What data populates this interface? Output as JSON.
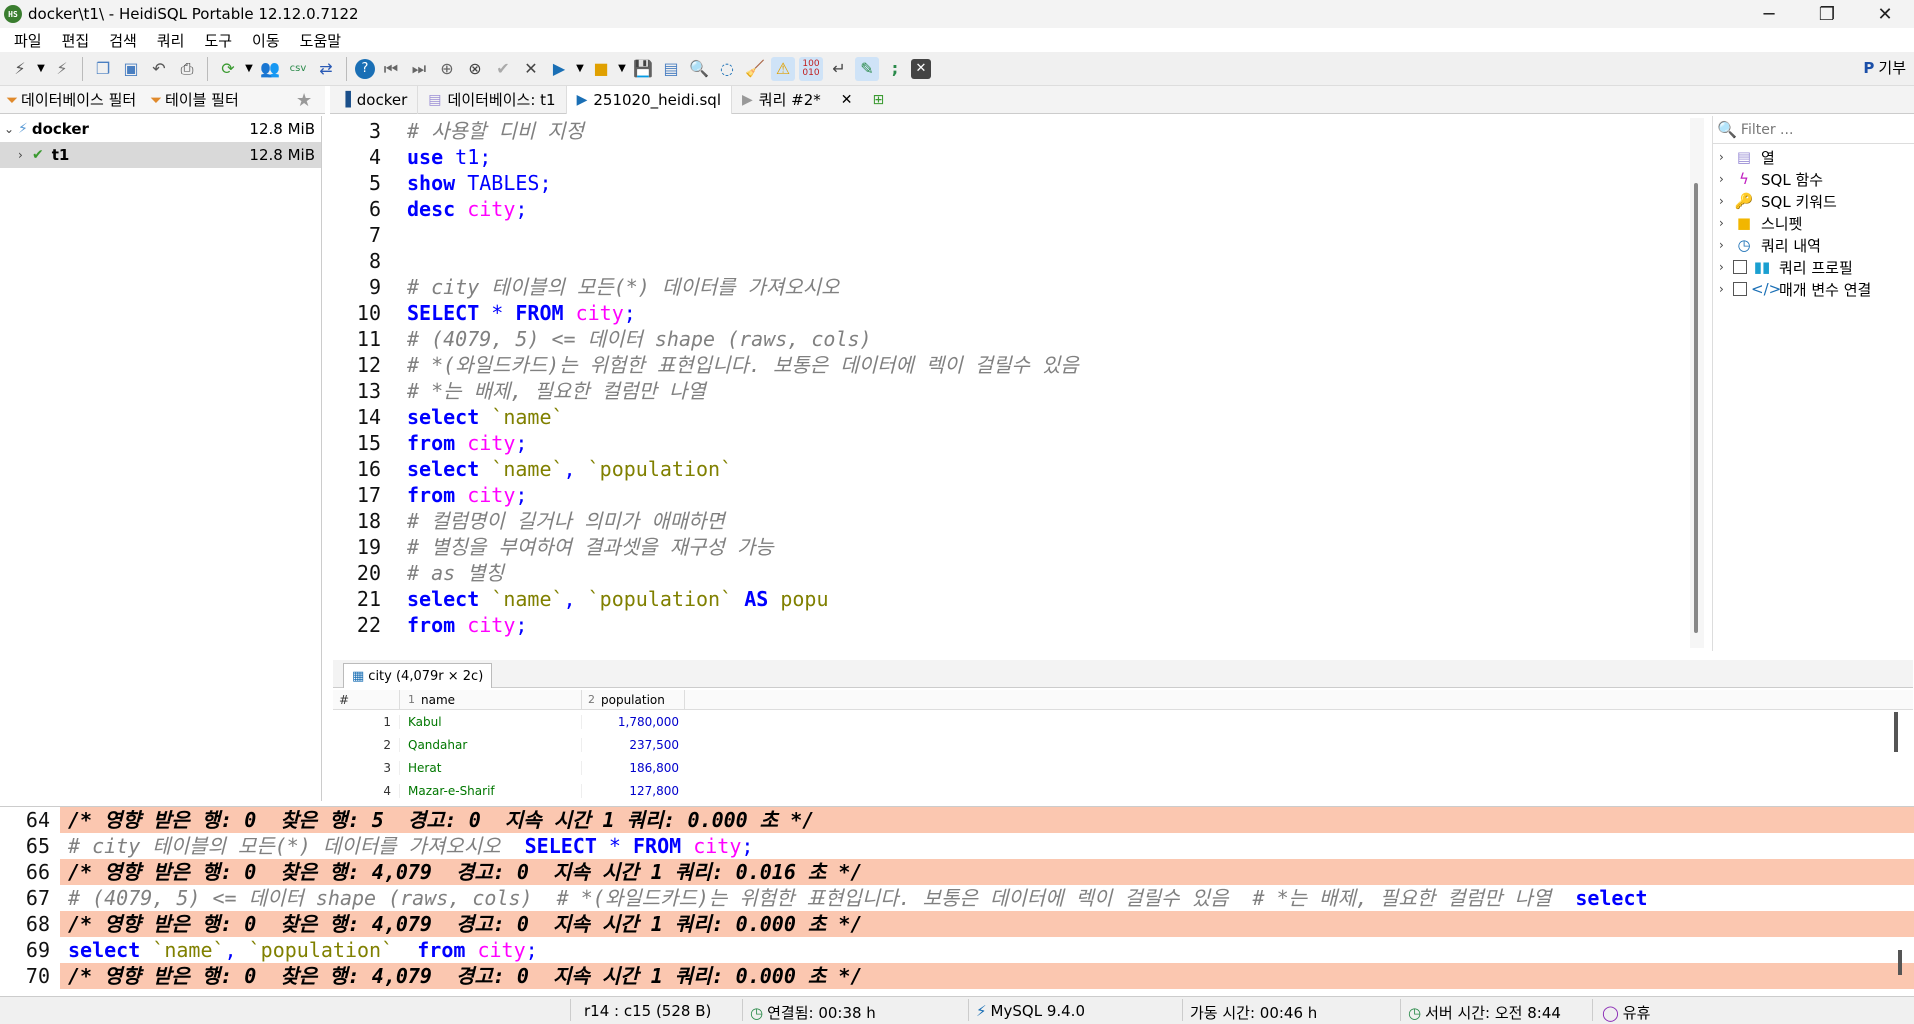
{
  "window": {
    "title": "docker\\t1\\ - HeidiSQL Portable 12.12.0.7122",
    "minimize": "─",
    "maximize": "❐",
    "close": "✕"
  },
  "menu": [
    "파일",
    "편집",
    "검색",
    "쿼리",
    "도구",
    "이동",
    "도움말"
  ],
  "donate_label": "기부",
  "left_tabs": {
    "db_filter": "데이터베이스 필터",
    "table_filter": "테이블 필터"
  },
  "tree": [
    {
      "name": "docker",
      "size": "12.8 MiB"
    },
    {
      "name": "t1",
      "size": "12.8 MiB"
    }
  ],
  "query_tabs": [
    {
      "label": "docker"
    },
    {
      "label": "데이터베이스: t1"
    },
    {
      "label": "251020_heidi.sql"
    },
    {
      "label": "쿼리 #2*"
    }
  ],
  "editor_lines": [
    {
      "n": "3",
      "parts": [
        {
          "t": "# 사용할 디비 지정",
          "c": "cm"
        }
      ]
    },
    {
      "n": "4",
      "parts": [
        {
          "t": "use",
          "c": "kw"
        },
        {
          "t": " t1;",
          "c": "pl"
        }
      ]
    },
    {
      "n": "5",
      "parts": [
        {
          "t": "show",
          "c": "kw"
        },
        {
          "t": " TABLES;",
          "c": "pl"
        }
      ]
    },
    {
      "n": "6",
      "parts": [
        {
          "t": "desc",
          "c": "kw"
        },
        {
          "t": " ",
          "c": "pl"
        },
        {
          "t": "city",
          "c": "id"
        },
        {
          "t": ";",
          "c": "pl"
        }
      ]
    },
    {
      "n": "7",
      "parts": []
    },
    {
      "n": "8",
      "parts": []
    },
    {
      "n": "9",
      "parts": [
        {
          "t": "# city 테이블의 모든(*) 데이터를 가져오시오",
          "c": "cm"
        }
      ]
    },
    {
      "n": "10",
      "parts": [
        {
          "t": "SELECT",
          "c": "kw"
        },
        {
          "t": " * ",
          "c": "pl"
        },
        {
          "t": "FROM",
          "c": "kw"
        },
        {
          "t": " ",
          "c": "pl"
        },
        {
          "t": "city",
          "c": "id"
        },
        {
          "t": ";",
          "c": "pl"
        }
      ]
    },
    {
      "n": "11",
      "parts": [
        {
          "t": "# (4079, 5) <= 데이터 shape (raws, cols)",
          "c": "cm"
        }
      ]
    },
    {
      "n": "12",
      "parts": [
        {
          "t": "# *(와일드카드)는 위험한 표현입니다. 보통은 데이터에 렉이 걸릴수 있음",
          "c": "cm"
        }
      ]
    },
    {
      "n": "13",
      "parts": [
        {
          "t": "# *는 배제, 필요한 컬럼만 나열",
          "c": "cm"
        }
      ]
    },
    {
      "n": "14",
      "parts": [
        {
          "t": "select",
          "c": "kw"
        },
        {
          "t": " ",
          "c": "pl"
        },
        {
          "t": "`name`",
          "c": "bt"
        }
      ]
    },
    {
      "n": "15",
      "parts": [
        {
          "t": "from",
          "c": "kw"
        },
        {
          "t": " ",
          "c": "pl"
        },
        {
          "t": "city",
          "c": "id"
        },
        {
          "t": ";",
          "c": "pl"
        }
      ]
    },
    {
      "n": "16",
      "parts": [
        {
          "t": "select",
          "c": "kw"
        },
        {
          "t": " ",
          "c": "pl"
        },
        {
          "t": "`name`",
          "c": "bt"
        },
        {
          "t": ", ",
          "c": "pl"
        },
        {
          "t": "`population`",
          "c": "bt"
        }
      ]
    },
    {
      "n": "17",
      "parts": [
        {
          "t": "from",
          "c": "kw"
        },
        {
          "t": " ",
          "c": "pl"
        },
        {
          "t": "city",
          "c": "id"
        },
        {
          "t": ";",
          "c": "pl"
        }
      ]
    },
    {
      "n": "18",
      "parts": [
        {
          "t": "# 컬럼명이 길거나 의미가 애매하면",
          "c": "cm"
        }
      ]
    },
    {
      "n": "19",
      "parts": [
        {
          "t": "# 별칭을 부여하여 결과셋을 재구성 가능",
          "c": "cm"
        }
      ]
    },
    {
      "n": "20",
      "parts": [
        {
          "t": "# as 별칭",
          "c": "cm"
        }
      ]
    },
    {
      "n": "21",
      "parts": [
        {
          "t": "select",
          "c": "kw"
        },
        {
          "t": " ",
          "c": "pl"
        },
        {
          "t": "`name`",
          "c": "bt"
        },
        {
          "t": ", ",
          "c": "pl"
        },
        {
          "t": "`population`",
          "c": "bt"
        },
        {
          "t": " ",
          "c": "pl"
        },
        {
          "t": "AS",
          "c": "kw"
        },
        {
          "t": " ",
          "c": "pl"
        },
        {
          "t": "popu",
          "c": "bt"
        }
      ]
    },
    {
      "n": "22",
      "parts": [
        {
          "t": "from",
          "c": "kw"
        },
        {
          "t": " ",
          "c": "pl"
        },
        {
          "t": "city",
          "c": "id"
        },
        {
          "t": ";",
          "c": "pl"
        }
      ]
    }
  ],
  "helper": {
    "filter_placeholder": "Filter ...",
    "items": [
      {
        "label": "열",
        "icon": "columns-icon",
        "glyph": "▤",
        "color": "#9b8fd6",
        "check": false
      },
      {
        "label": "SQL 함수",
        "icon": "function-icon",
        "glyph": "ϟ",
        "color": "#c020c0",
        "check": false
      },
      {
        "label": "SQL 키워드",
        "icon": "keyword-icon",
        "glyph": "🔑",
        "color": "#e0a000",
        "check": false
      },
      {
        "label": "스니펫",
        "icon": "folder-icon",
        "glyph": "■",
        "color": "#f2b600",
        "check": false
      },
      {
        "label": "쿼리 내역",
        "icon": "clock-icon",
        "glyph": "◷",
        "color": "#1a6fb5",
        "check": false
      },
      {
        "label": "쿼리 프로필",
        "icon": "chart-icon",
        "glyph": "▮▮",
        "color": "#1a9fd0",
        "check": true
      },
      {
        "label": "매개 변수 연결",
        "icon": "code-icon",
        "glyph": "</>",
        "color": "#1a6fb5",
        "check": true
      }
    ]
  },
  "results": {
    "tab_label": "city (4,079r × 2c)",
    "columns": [
      {
        "idx": "#",
        "label": ""
      },
      {
        "idx": "1",
        "label": "name"
      },
      {
        "idx": "2",
        "label": "population"
      }
    ],
    "rows": [
      {
        "n": "1",
        "name": "Kabul",
        "population": "1,780,000"
      },
      {
        "n": "2",
        "name": "Qandahar",
        "population": "237,500"
      },
      {
        "n": "3",
        "name": "Herat",
        "population": "186,800"
      },
      {
        "n": "4",
        "name": "Mazar-e-Sharif",
        "population": "127,800"
      }
    ]
  },
  "log_lines": [
    {
      "n": "64",
      "warn": true,
      "parts": [
        {
          "t": "/* 영향 받은 행: 0  찾은 행: 5  경고: 0  지속 시간 1 쿼리: 0.000 초 */",
          "c": "logc"
        }
      ]
    },
    {
      "n": "65",
      "warn": false,
      "parts": [
        {
          "t": "# city 테이블의 모든(*) 데이터를 가져오시오  ",
          "c": "cm"
        },
        {
          "t": "SELECT",
          "c": "kw"
        },
        {
          "t": " * ",
          "c": "pl"
        },
        {
          "t": "FROM",
          "c": "kw"
        },
        {
          "t": " ",
          "c": "pl"
        },
        {
          "t": "city",
          "c": "id"
        },
        {
          "t": ";",
          "c": "pl"
        }
      ]
    },
    {
      "n": "66",
      "warn": true,
      "parts": [
        {
          "t": "/* 영향 받은 행: 0  찾은 행: 4,079  경고: 0  지속 시간 1 쿼리: 0.016 초 */",
          "c": "logc"
        }
      ]
    },
    {
      "n": "67",
      "warn": false,
      "parts": [
        {
          "t": "# (4079, 5) <= 데이터 shape (raws, cols)  # *(와일드카드)는 위험한 표현입니다. 보통은 데이터에 렉이 걸릴수 있음  # *는 배제, 필요한 컬럼만 나열  ",
          "c": "cm"
        },
        {
          "t": "select",
          "c": "kw"
        }
      ]
    },
    {
      "n": "68",
      "warn": true,
      "parts": [
        {
          "t": "/* 영향 받은 행: 0  찾은 행: 4,079  경고: 0  지속 시간 1 쿼리: 0.000 초 */",
          "c": "logc"
        }
      ]
    },
    {
      "n": "69",
      "warn": false,
      "parts": [
        {
          "t": "select",
          "c": "kw"
        },
        {
          "t": " ",
          "c": "pl"
        },
        {
          "t": "`name`",
          "c": "bt"
        },
        {
          "t": ", ",
          "c": "pl"
        },
        {
          "t": "`population`",
          "c": "bt"
        },
        {
          "t": "  ",
          "c": "pl"
        },
        {
          "t": "from",
          "c": "kw"
        },
        {
          "t": " ",
          "c": "pl"
        },
        {
          "t": "city",
          "c": "id"
        },
        {
          "t": ";",
          "c": "pl"
        }
      ]
    },
    {
      "n": "70",
      "warn": true,
      "parts": [
        {
          "t": "/* 영향 받은 행: 0  찾은 행: 4,079  경고: 0  지속 시간 1 쿼리: 0.000 초 */",
          "c": "logc"
        }
      ]
    }
  ],
  "status": {
    "cursor": "r14 : c15 (528 B)",
    "connected": "연결됨: 00:38 h",
    "server": "MySQL 9.4.0",
    "uptime": "가동 시간: 00:46 h",
    "server_time": "서버 시간: 오전 8:44",
    "idle": "유휴"
  },
  "colors": {
    "keyword": "#0000ff",
    "identifier": "#ff00ff",
    "comment": "#808080",
    "backtick": "#808000",
    "warn_bg": "#fbc7b0"
  }
}
